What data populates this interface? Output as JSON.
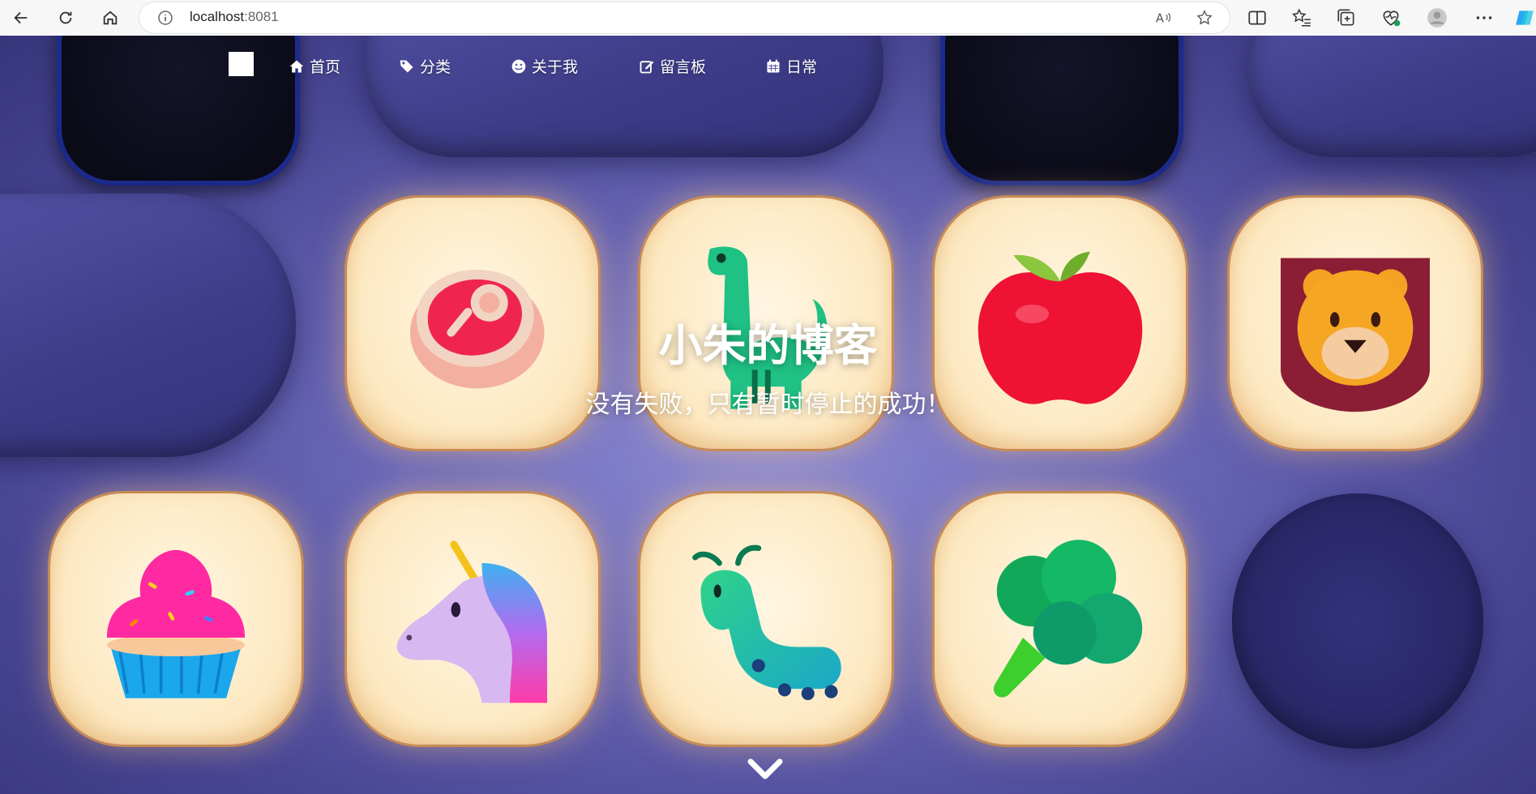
{
  "browser": {
    "url_host": "localhost",
    "url_port": ":8081"
  },
  "nav": {
    "items": [
      {
        "label": "首页",
        "icon": "home-icon"
      },
      {
        "label": "分类",
        "icon": "tags-icon"
      },
      {
        "label": "关于我",
        "icon": "smile-icon"
      },
      {
        "label": "留言板",
        "icon": "edit-icon"
      },
      {
        "label": "日常",
        "icon": "calendar-icon"
      }
    ]
  },
  "hero": {
    "title": "小朱的博客",
    "subtitle": "没有失败，只有暂时停止的成功！"
  },
  "tiles": [
    "meat",
    "dinosaur",
    "apple",
    "lion",
    "cupcake",
    "unicorn",
    "caterpillar",
    "broccoli"
  ],
  "colors": {
    "tile_bg": "#fde9c2",
    "page_bg": "#6b68b8",
    "text": "#ffffff"
  }
}
